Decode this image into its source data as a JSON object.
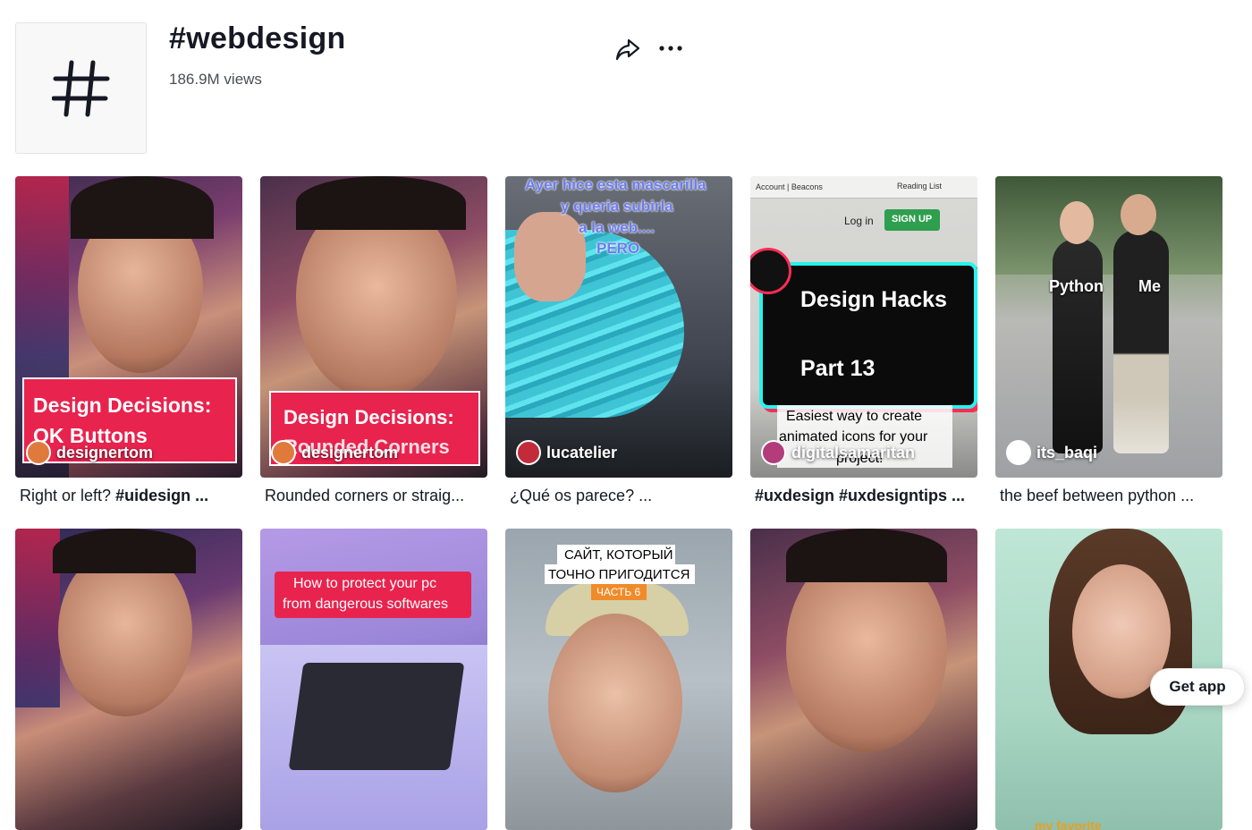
{
  "header": {
    "title": "#webdesign",
    "views": "186.9M views",
    "hash_symbol": "#",
    "share_icon": "share-icon",
    "more_icon": "more-icon"
  },
  "videos": [
    {
      "author": "designertom",
      "caption_text": "Right or left? ",
      "caption_tag": "#uidesign ...",
      "overlay": [
        "Design Decisions:",
        "OK Buttons"
      ]
    },
    {
      "author": "designertom",
      "caption_text": "Rounded corners or straig...",
      "caption_tag": "",
      "overlay": [
        "Design Decisions:",
        "Rounded Corners"
      ]
    },
    {
      "author": "lucatelier",
      "caption_text": "¿Qué os parece? ...",
      "caption_tag": "",
      "overlay": [
        "Ayer hice esta mascarilla",
        "y queria subirla",
        "a la web....",
        "PERO"
      ]
    },
    {
      "author": "digitalsamaritan",
      "caption_text": "",
      "caption_tag": "#uxdesign #uxdesigntips ...",
      "overlay": [
        "Design Hacks",
        "Part 13",
        "Easiest way to create",
        "animated icons for your",
        "project!",
        "Account | Beacons",
        "Reading List",
        "Log in",
        "SIGN UP"
      ]
    },
    {
      "author": "its_baqi",
      "caption_text": "the beef between python ...",
      "caption_tag": "",
      "overlay": [
        "Python",
        "Me"
      ]
    },
    {
      "author": "",
      "caption_text": "",
      "caption_tag": "",
      "overlay": []
    },
    {
      "author": "",
      "caption_text": "",
      "caption_tag": "",
      "overlay": [
        "How to protect your pc",
        "from dangerous softwares"
      ]
    },
    {
      "author": "",
      "caption_text": "",
      "caption_tag": "",
      "overlay": [
        "САЙТ, КОТОРЫЙ",
        "ТОЧНО ПРИГОДИТСЯ",
        "ЧАСТЬ 6"
      ]
    },
    {
      "author": "",
      "caption_text": "",
      "caption_tag": "",
      "overlay": []
    },
    {
      "author": "",
      "caption_text": "",
      "caption_tag": "",
      "overlay": [
        "my favorite"
      ]
    }
  ],
  "get_app": "Get app",
  "colors": {
    "accent_pink": "#e8234e",
    "tiktok_cyan": "#25f4ee",
    "tiktok_red": "#fe2c55",
    "signup_green": "#2e9e4f"
  }
}
